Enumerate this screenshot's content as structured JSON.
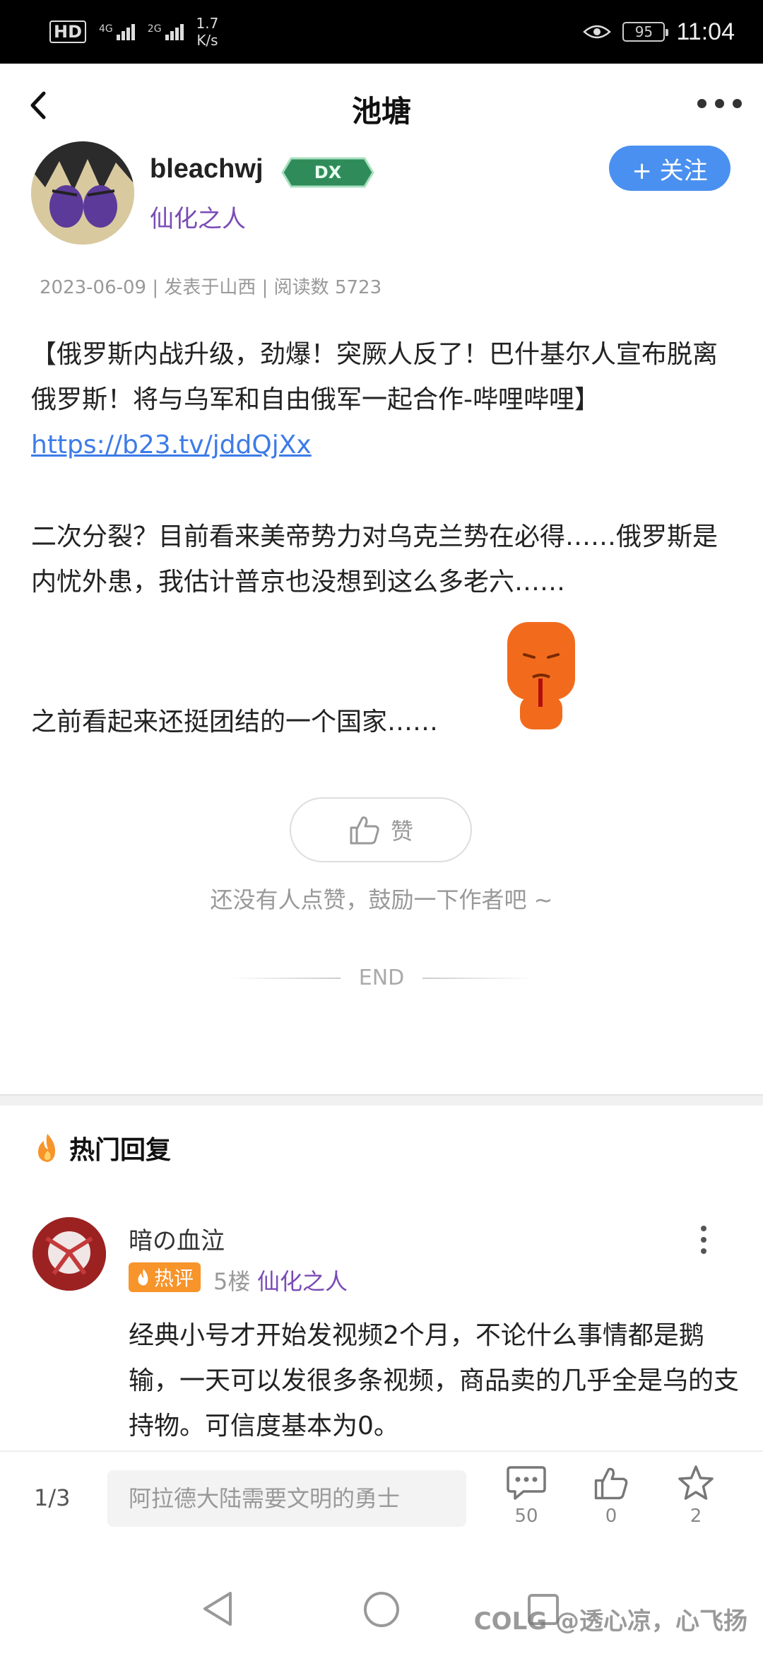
{
  "status_bar": {
    "hd_label": "HD",
    "signal1_label": "4G",
    "signal2_label": "2G",
    "net_speed_value": "1.7",
    "net_speed_unit": "K/s",
    "battery": "95",
    "time": "11:04"
  },
  "header": {
    "title": "池塘"
  },
  "author": {
    "name": "bleachwj",
    "level_badge": "DX",
    "title": "仙化之人",
    "follow_label": "+ 关注"
  },
  "post": {
    "meta": "2023-06-09 | 发表于山西 | 阅读数 5723",
    "paragraph1": "【俄罗斯内战升级，劲爆！突厥人反了！巴什基尔人宣布脱离俄罗斯！将与乌军和自由俄军一起合作-哔哩哔哩】",
    "link": "https://b23.tv/jddQjXx",
    "paragraph2": "二次分裂？目前看来美帝势力对乌克兰势在必得……俄罗斯是内忧外患，我估计普京也没想到这么多老六……",
    "paragraph3": "之前看起来还挺团结的一个国家……"
  },
  "like": {
    "label": "赞",
    "hint": "还没有人点赞，鼓励一下作者吧 ~",
    "end_label": "END"
  },
  "hot_replies": {
    "heading": "热门回复",
    "items": [
      {
        "user": "暗の血泣",
        "badge": "热评",
        "floor": "5楼",
        "title": "仙化之人",
        "text": "经典小号才开始发视频2个月，不论什么事情都是鹅输，一天可以发很多条视频，商品卖的几乎全是乌的支持物。可信度基本为0。"
      }
    ]
  },
  "bottom_bar": {
    "page_indicator": "1/3",
    "input_placeholder": "阿拉德大陆需要文明的勇士",
    "comments_count": "50",
    "likes_count": "0",
    "favorites_count": "2"
  },
  "watermark": "COLG @透心凉，心飞扬",
  "colors": {
    "accent": "#4a90f0",
    "title_purple": "#7a4bb5",
    "hot_orange": "#f7942a",
    "link_blue": "#3d7be8"
  }
}
